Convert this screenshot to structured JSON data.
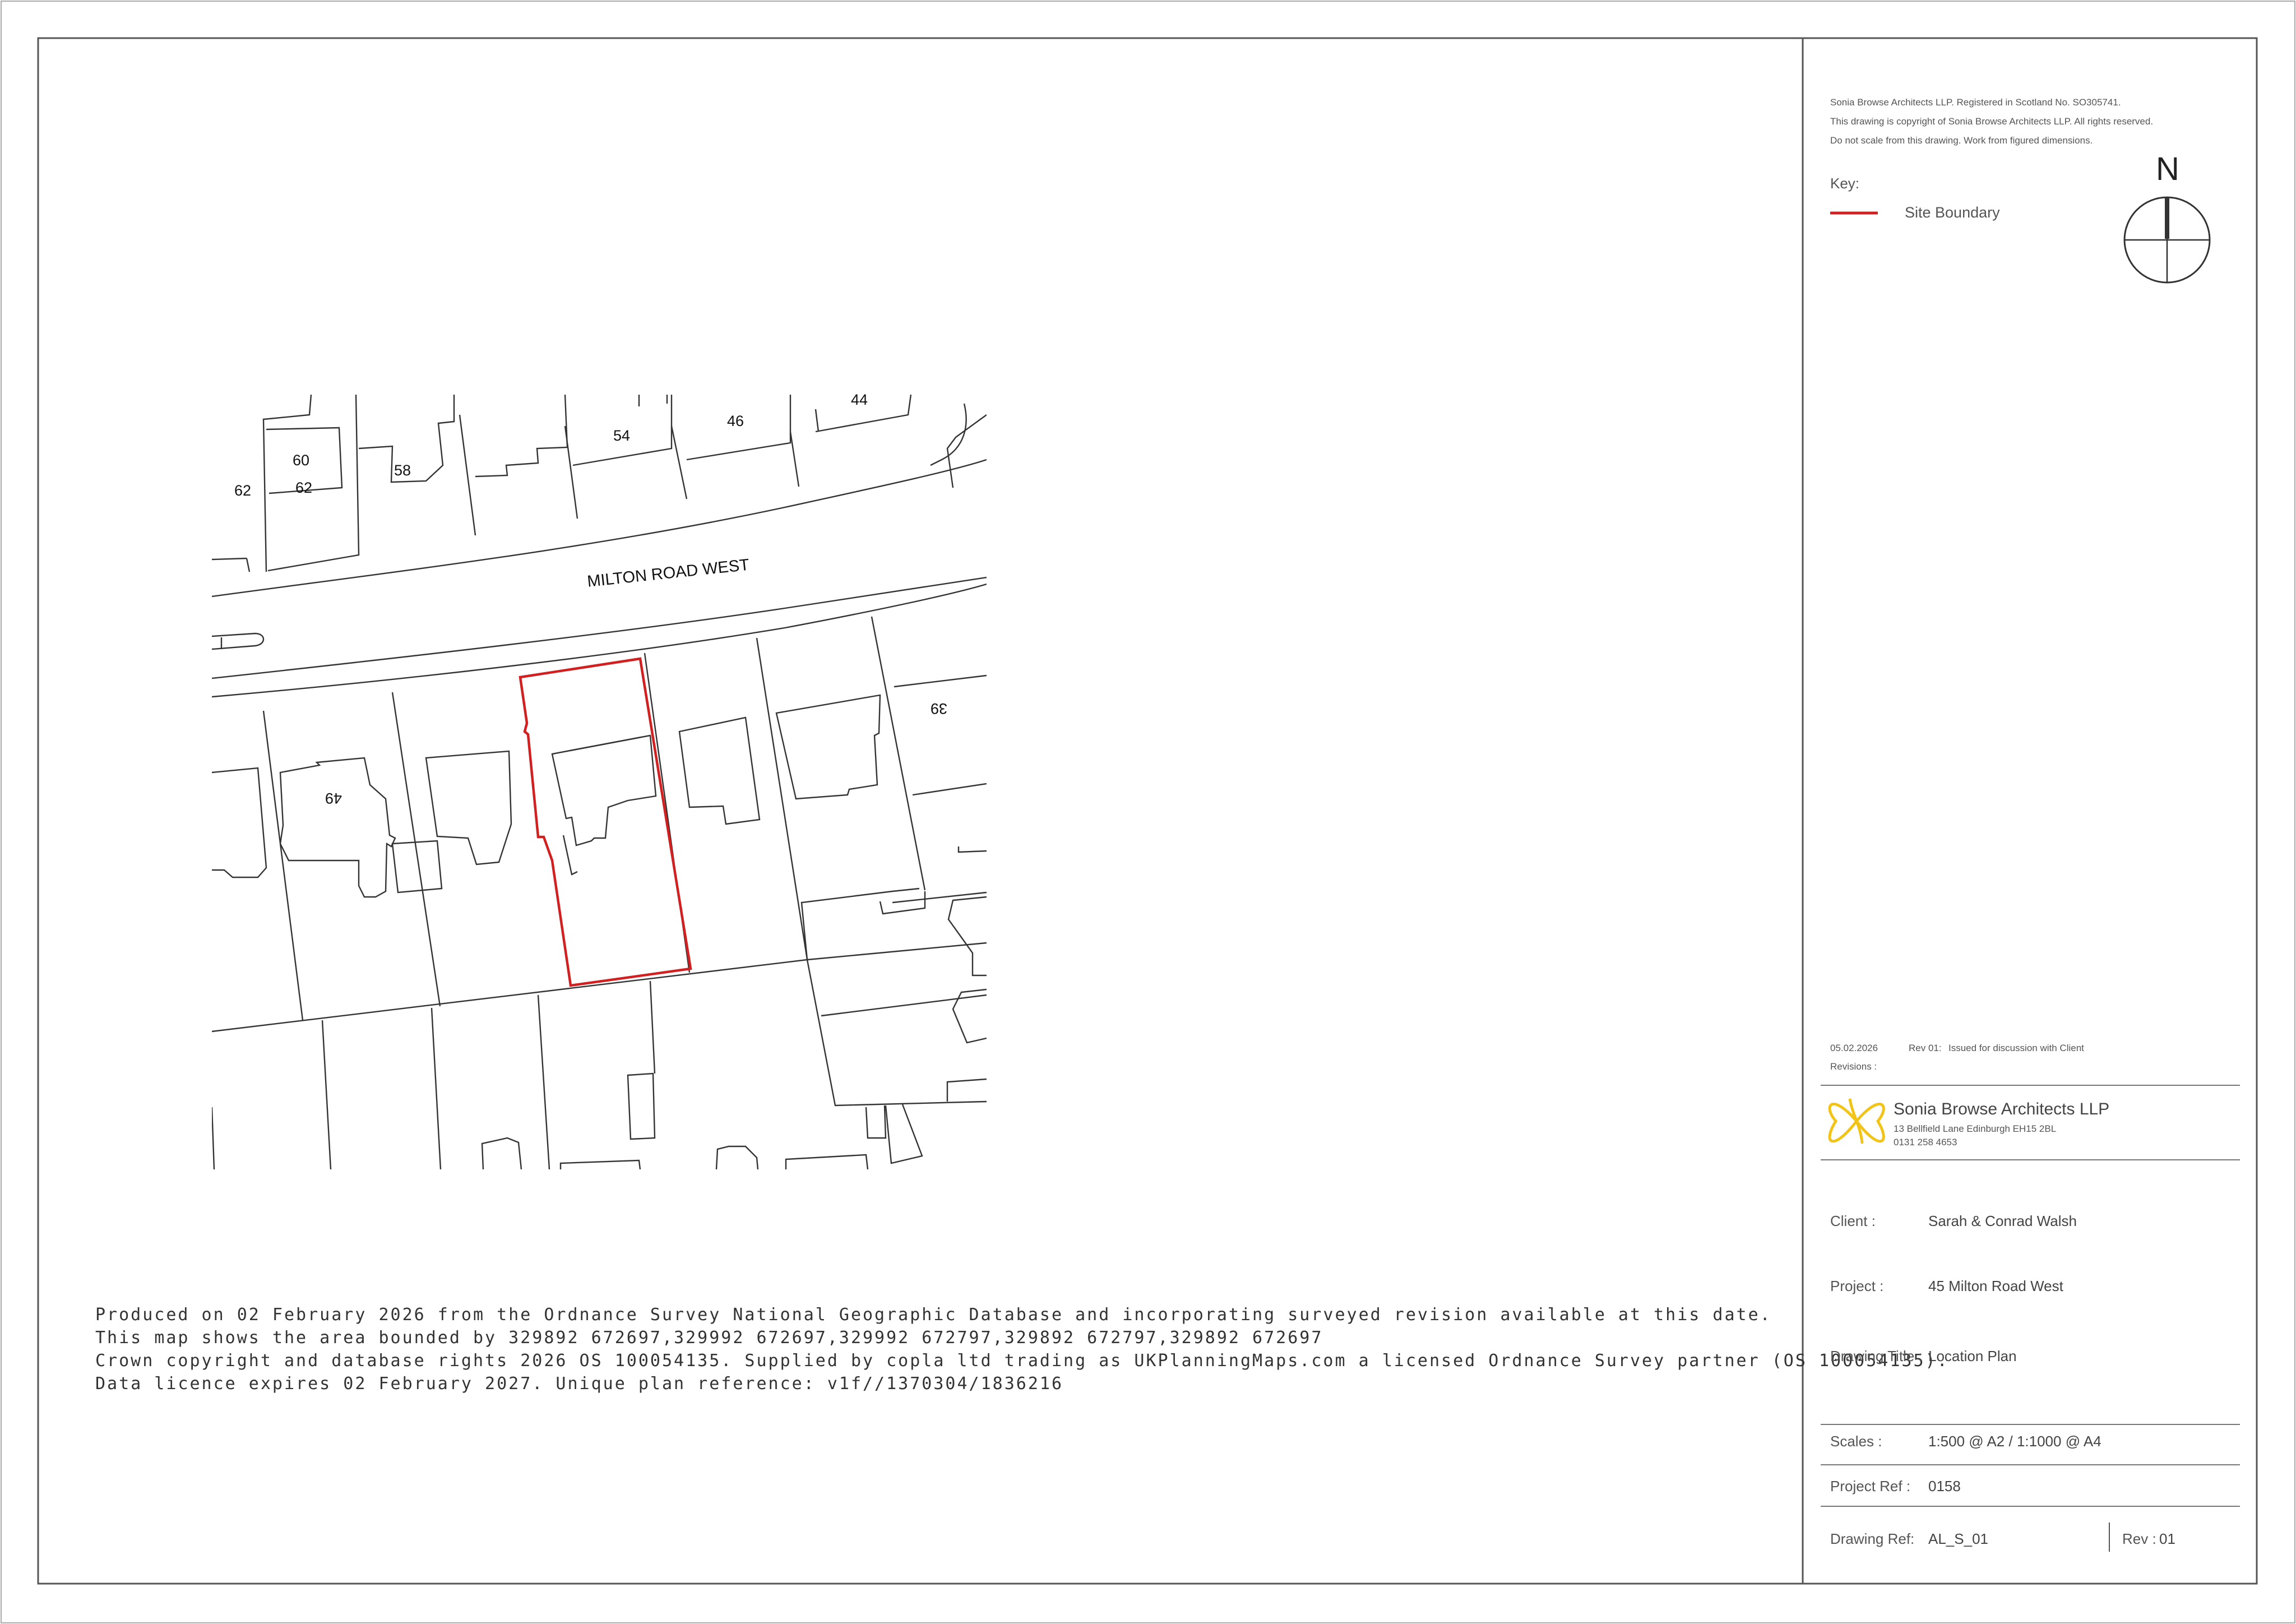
{
  "notes": [
    "Sonia Browse Architects LLP. Registered in Scotland No. SO305741.",
    "This drawing is copyright of Sonia Browse Architects LLP. All rights reserved.",
    "Do not scale from this drawing. Work from figured dimensions."
  ],
  "key": {
    "title": "Key:",
    "site_boundary_label": "Site Boundary",
    "site_boundary_color": "#d21f1f"
  },
  "north": "N",
  "map": {
    "road_name": "MILTON ROAD WEST",
    "house_numbers": [
      "44",
      "46",
      "54",
      "58",
      "60",
      "62",
      "62",
      "39",
      "49"
    ]
  },
  "os_notice": [
    "Produced on 02 February 2026 from the Ordnance Survey National Geographic Database and incorporating surveyed revision available at this date.",
    "This map shows the area bounded by 329892 672697,329992 672697,329992 672797,329892 672797,329892 672697",
    "Crown copyright and database rights 2026 OS 100054135. Supplied by copla ltd trading as UKPlanningMaps.com a licensed Ordnance Survey partner (OS 100054135).",
    "Data licence expires 02 February 2027. Unique plan reference: v1f//1370304/1836216"
  ],
  "revisions": {
    "date": "05.02.2026",
    "rev": "Rev 01:",
    "description": "Issued for discussion with Client",
    "label": "Revisions :"
  },
  "practice": {
    "name": "Sonia Browse Architects LLP",
    "address": "13 Bellfield Lane Edinburgh EH15 2BL",
    "phone": "0131 258 4653",
    "logo_color": "#f2c418"
  },
  "client": {
    "label": "Client :",
    "value": "Sarah & Conrad Walsh"
  },
  "project": {
    "label": "Project :",
    "value": "45 Milton Road West"
  },
  "drawing_title": {
    "label": "Drawing Title :",
    "value": "Location Plan"
  },
  "scales": {
    "label": "Scales :",
    "value": "1:500 @ A2 / 1:1000 @ A4"
  },
  "project_ref": {
    "label": "Project Ref :",
    "value": "0158"
  },
  "drawing_ref": {
    "label": "Drawing Ref:",
    "value": "AL_S_01"
  },
  "rev": {
    "label": "Rev :",
    "value": "01"
  }
}
